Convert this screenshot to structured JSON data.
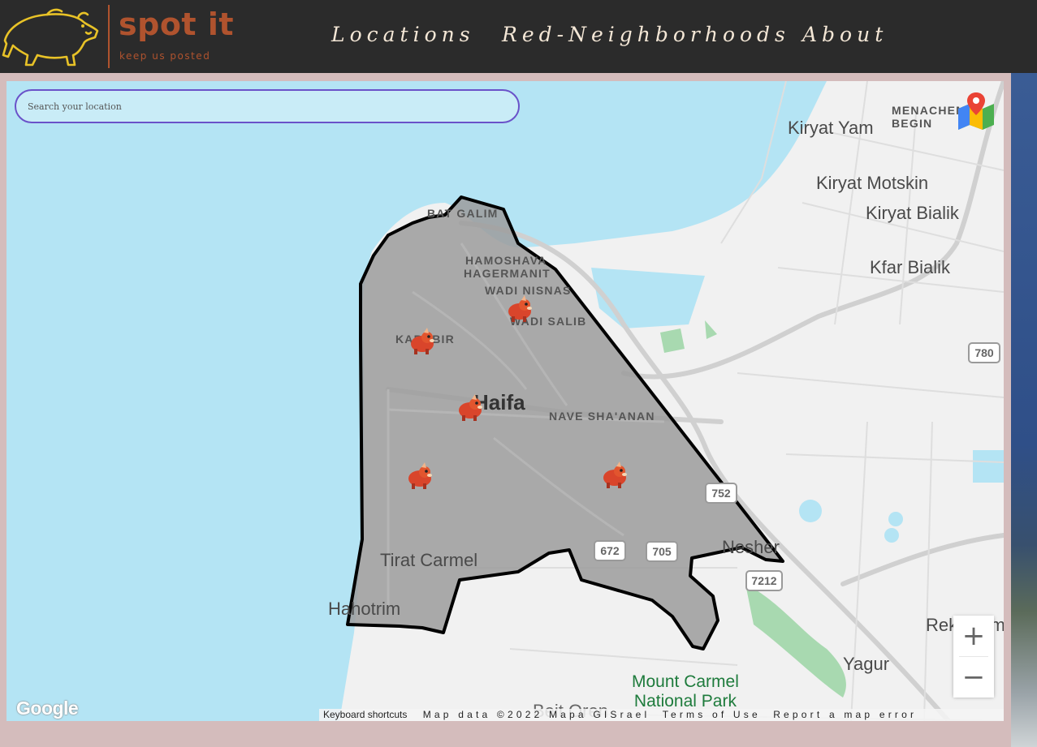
{
  "header": {
    "brand_name": "spot it",
    "tagline": "keep us posted",
    "nav": [
      "Locations",
      "Red-Neighborhoods",
      "About"
    ]
  },
  "search": {
    "placeholder": "Search your location",
    "value": ""
  },
  "map": {
    "labels": {
      "menachem_begin": "MENACHEM BEGIN",
      "kiryat_yam": "Kiryat Yam",
      "kiryat_motskin": "Kiryat Motskin",
      "kiryat_bialik": "Kiryat Bialik",
      "kfar_bialik": "Kfar Bialik",
      "bat_galim": "BAT GALIM",
      "hamoshava": "HAMOSHAVA",
      "hagermanit": "HAGERMANIT",
      "wadi_nisnas": "WADI NISNAS",
      "wadi_salib": "WADI SALIB",
      "kababir": "KABABIR",
      "haifa": "Haifa",
      "nave_shaanan": "NAVE SHA'ANAN",
      "tirat_carmel": "Tirat Carmel",
      "hahotrim": "Hahotrim",
      "nesher": "Nesher",
      "rekhasim": "Rekhasim",
      "yagur": "Yagur",
      "mount_carmel_1": "Mount Carmel",
      "mount_carmel_2": "National Park",
      "beit_oren": "Beit Oren"
    },
    "road_shields": [
      "780",
      "752",
      "672",
      "705",
      "7212"
    ],
    "markers_count": 5,
    "zoom_in": "+",
    "zoom_out": "−",
    "google_logo": "Google",
    "attribution": {
      "shortcuts": "Keyboard shortcuts",
      "map_data": "Map data ©2022 Mapa GISrael",
      "terms": "Terms of Use",
      "report": "Report a map error"
    }
  },
  "colors": {
    "navbar": "#2b2b2b",
    "brand": "#b0532e",
    "nav_text": "#f4e7d6",
    "page_bg": "#d4bcbc",
    "water": "#b4e4f4",
    "polygon_fill": "#9c9c9c",
    "search_border": "#6a52c9"
  }
}
